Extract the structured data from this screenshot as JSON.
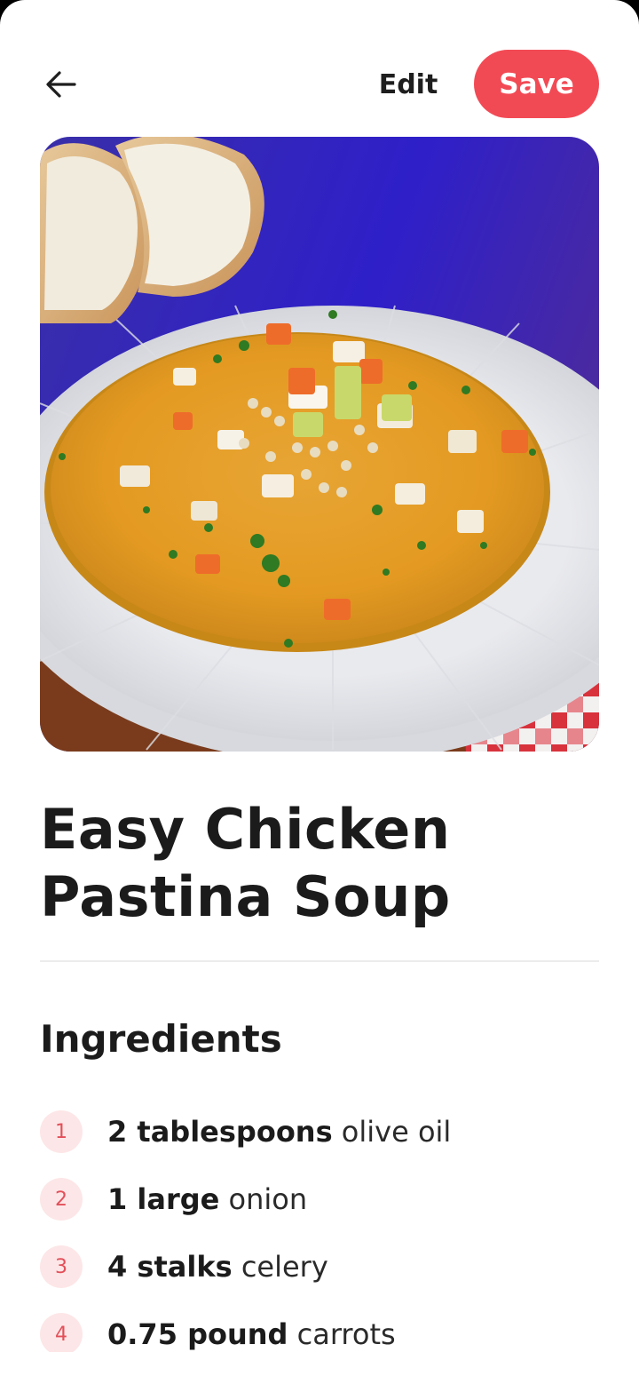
{
  "header": {
    "back_icon": "arrow-left-icon",
    "edit_label": "Edit",
    "save_label": "Save"
  },
  "recipe": {
    "title_line1": "Easy Chicken",
    "title_line2": "Pastina Soup"
  },
  "ingredients": {
    "heading": "Ingredients",
    "items": [
      {
        "number": "1",
        "quantity": "2 tablespoons",
        "name": "olive oil"
      },
      {
        "number": "2",
        "quantity": "1 large",
        "name": "onion"
      },
      {
        "number": "3",
        "quantity": "4 stalks",
        "name": "celery"
      },
      {
        "number": "4",
        "quantity": "0.75 pound",
        "name": "carrots"
      }
    ]
  },
  "colors": {
    "accent": "#f24a55",
    "badge_bg": "#fde6e7",
    "text": "#1b1b1b"
  }
}
